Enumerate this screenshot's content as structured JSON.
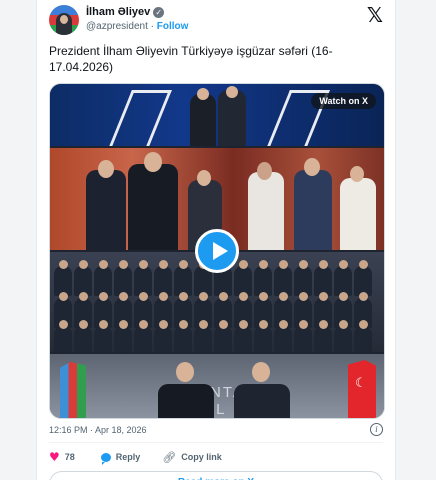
{
  "author": {
    "name": "İlham Əliyev",
    "handle": "@azpresident",
    "separator": "·",
    "follow_label": "Follow",
    "verified_icon": "verified-badge-icon"
  },
  "tweet": {
    "text": "Prezident İlham Əliyevin Türkiyəyə işgüzar səfəri (16-17.04.2026)"
  },
  "media": {
    "watch_label": "Watch on X",
    "play_icon": "play-icon",
    "backdrop_text": "ANTA\nIPL"
  },
  "meta": {
    "timestamp": "12:16 PM · Apr 18, 2026"
  },
  "actions": {
    "like_count": "78",
    "reply_label": "Reply",
    "copy_link_label": "Copy link",
    "read_more_label": "Read more on X"
  },
  "colors": {
    "accent": "#1d9bf0",
    "like": "#f91880",
    "text": "#0f1419",
    "muted": "#536471"
  }
}
